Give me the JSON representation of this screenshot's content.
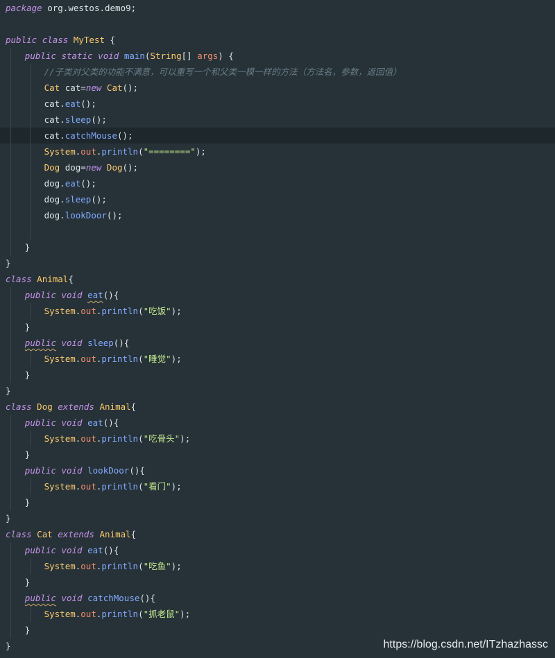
{
  "editor": {
    "theme": {
      "background": "#263238",
      "current_line": "#1e272c",
      "keyword": "#c792ea",
      "class_name": "#ffcb6b",
      "function": "#82aaff",
      "field": "#f78c6c",
      "string": "#c3e88d",
      "comment": "#697c86",
      "text": "#dde4e8"
    },
    "current_line_index": 8,
    "lines": [
      {
        "indent": 0,
        "tokens": [
          [
            "kw",
            "package"
          ],
          [
            "plain",
            " org.westos.demo9;"
          ]
        ]
      },
      {
        "indent": 0,
        "tokens": []
      },
      {
        "indent": 0,
        "tokens": [
          [
            "kw",
            "public"
          ],
          [
            "plain",
            " "
          ],
          [
            "kw",
            "class"
          ],
          [
            "plain",
            " "
          ],
          [
            "cls",
            "MyTest"
          ],
          [
            "plain",
            " {"
          ]
        ]
      },
      {
        "indent": 1,
        "tokens": [
          [
            "kw",
            "public"
          ],
          [
            "plain",
            " "
          ],
          [
            "kw",
            "static"
          ],
          [
            "plain",
            " "
          ],
          [
            "kw",
            "void"
          ],
          [
            "plain",
            " "
          ],
          [
            "fn",
            "main"
          ],
          [
            "plain",
            "("
          ],
          [
            "cls",
            "String"
          ],
          [
            "plain",
            "[] "
          ],
          [
            "param",
            "args"
          ],
          [
            "plain",
            ") {"
          ]
        ]
      },
      {
        "indent": 2,
        "tokens": [
          [
            "cmt",
            "//子类对父类的功能不满意，可以重写一个和父类一模一样的方法（方法名，参数，返回值）"
          ]
        ]
      },
      {
        "indent": 2,
        "tokens": [
          [
            "cls",
            "Cat"
          ],
          [
            "plain",
            " cat="
          ],
          [
            "kw",
            "new"
          ],
          [
            "plain",
            " "
          ],
          [
            "cls",
            "Cat"
          ],
          [
            "plain",
            "();"
          ]
        ]
      },
      {
        "indent": 2,
        "tokens": [
          [
            "plain",
            "cat."
          ],
          [
            "fn",
            "eat"
          ],
          [
            "plain",
            "();"
          ]
        ]
      },
      {
        "indent": 2,
        "tokens": [
          [
            "plain",
            "cat."
          ],
          [
            "fn",
            "sleep"
          ],
          [
            "plain",
            "();"
          ]
        ]
      },
      {
        "indent": 2,
        "tokens": [
          [
            "plain",
            "cat."
          ],
          [
            "fn",
            "catchMouse"
          ],
          [
            "plain",
            "();"
          ]
        ]
      },
      {
        "indent": 2,
        "tokens": [
          [
            "cls",
            "System"
          ],
          [
            "plain",
            "."
          ],
          [
            "mem",
            "out"
          ],
          [
            "plain",
            "."
          ],
          [
            "fn",
            "println"
          ],
          [
            "plain",
            "("
          ],
          [
            "str",
            "\"========\""
          ],
          [
            "plain",
            ");"
          ]
        ]
      },
      {
        "indent": 2,
        "tokens": [
          [
            "cls",
            "Dog"
          ],
          [
            "plain",
            " dog="
          ],
          [
            "kw",
            "new"
          ],
          [
            "plain",
            " "
          ],
          [
            "cls",
            "Dog"
          ],
          [
            "plain",
            "();"
          ]
        ]
      },
      {
        "indent": 2,
        "tokens": [
          [
            "plain",
            "dog."
          ],
          [
            "fn",
            "eat"
          ],
          [
            "plain",
            "();"
          ]
        ]
      },
      {
        "indent": 2,
        "tokens": [
          [
            "plain",
            "dog."
          ],
          [
            "fn",
            "sleep"
          ],
          [
            "plain",
            "();"
          ]
        ]
      },
      {
        "indent": 2,
        "tokens": [
          [
            "plain",
            "dog."
          ],
          [
            "fn",
            "lookDoor"
          ],
          [
            "plain",
            "();"
          ]
        ]
      },
      {
        "indent": 2,
        "tokens": []
      },
      {
        "indent": 1,
        "tokens": [
          [
            "plain",
            "}"
          ]
        ]
      },
      {
        "indent": 0,
        "tokens": [
          [
            "plain",
            "}"
          ]
        ]
      },
      {
        "indent": 0,
        "tokens": [
          [
            "kw",
            "class"
          ],
          [
            "plain",
            " "
          ],
          [
            "cls",
            "Animal"
          ],
          [
            "plain",
            "{"
          ]
        ]
      },
      {
        "indent": 1,
        "tokens": [
          [
            "kw",
            "public"
          ],
          [
            "plain",
            " "
          ],
          [
            "kw",
            "void"
          ],
          [
            "plain",
            " "
          ],
          [
            "fn-warn",
            "eat"
          ],
          [
            "plain",
            "(){"
          ]
        ]
      },
      {
        "indent": 2,
        "tokens": [
          [
            "cls",
            "System"
          ],
          [
            "plain",
            "."
          ],
          [
            "mem",
            "out"
          ],
          [
            "plain",
            "."
          ],
          [
            "fn",
            "println"
          ],
          [
            "plain",
            "("
          ],
          [
            "str",
            "\"吃饭\""
          ],
          [
            "plain",
            ");"
          ]
        ]
      },
      {
        "indent": 1,
        "tokens": [
          [
            "plain",
            "}"
          ]
        ]
      },
      {
        "indent": 1,
        "tokens": [
          [
            "kw-warn",
            "public"
          ],
          [
            "plain",
            " "
          ],
          [
            "kw",
            "void"
          ],
          [
            "plain",
            " "
          ],
          [
            "fn",
            "sleep"
          ],
          [
            "plain",
            "(){"
          ]
        ]
      },
      {
        "indent": 2,
        "tokens": [
          [
            "cls",
            "System"
          ],
          [
            "plain",
            "."
          ],
          [
            "mem",
            "out"
          ],
          [
            "plain",
            "."
          ],
          [
            "fn",
            "println"
          ],
          [
            "plain",
            "("
          ],
          [
            "str",
            "\"睡觉\""
          ],
          [
            "plain",
            ");"
          ]
        ]
      },
      {
        "indent": 1,
        "tokens": [
          [
            "plain",
            "}"
          ]
        ]
      },
      {
        "indent": 0,
        "tokens": [
          [
            "plain",
            "}"
          ]
        ]
      },
      {
        "indent": 0,
        "tokens": [
          [
            "kw",
            "class"
          ],
          [
            "plain",
            " "
          ],
          [
            "cls",
            "Dog"
          ],
          [
            "plain",
            " "
          ],
          [
            "kw",
            "extends"
          ],
          [
            "plain",
            " "
          ],
          [
            "cls",
            "Animal"
          ],
          [
            "plain",
            "{"
          ]
        ]
      },
      {
        "indent": 1,
        "tokens": [
          [
            "kw",
            "public"
          ],
          [
            "plain",
            " "
          ],
          [
            "kw",
            "void"
          ],
          [
            "plain",
            " "
          ],
          [
            "fn",
            "eat"
          ],
          [
            "plain",
            "(){"
          ]
        ]
      },
      {
        "indent": 2,
        "tokens": [
          [
            "cls",
            "System"
          ],
          [
            "plain",
            "."
          ],
          [
            "mem",
            "out"
          ],
          [
            "plain",
            "."
          ],
          [
            "fn",
            "println"
          ],
          [
            "plain",
            "("
          ],
          [
            "str",
            "\"吃骨头\""
          ],
          [
            "plain",
            ");"
          ]
        ]
      },
      {
        "indent": 1,
        "tokens": [
          [
            "plain",
            "}"
          ]
        ]
      },
      {
        "indent": 1,
        "tokens": [
          [
            "kw",
            "public"
          ],
          [
            "plain",
            " "
          ],
          [
            "kw",
            "void"
          ],
          [
            "plain",
            " "
          ],
          [
            "fn",
            "lookDoor"
          ],
          [
            "plain",
            "(){"
          ]
        ]
      },
      {
        "indent": 2,
        "tokens": [
          [
            "cls",
            "System"
          ],
          [
            "plain",
            "."
          ],
          [
            "mem",
            "out"
          ],
          [
            "plain",
            "."
          ],
          [
            "fn",
            "println"
          ],
          [
            "plain",
            "("
          ],
          [
            "str",
            "\"看门\""
          ],
          [
            "plain",
            ");"
          ]
        ]
      },
      {
        "indent": 1,
        "tokens": [
          [
            "plain",
            "}"
          ]
        ]
      },
      {
        "indent": 0,
        "tokens": [
          [
            "plain",
            "}"
          ]
        ]
      },
      {
        "indent": 0,
        "tokens": [
          [
            "kw",
            "class"
          ],
          [
            "plain",
            " "
          ],
          [
            "cls",
            "Cat"
          ],
          [
            "plain",
            " "
          ],
          [
            "kw",
            "extends"
          ],
          [
            "plain",
            " "
          ],
          [
            "cls",
            "Animal"
          ],
          [
            "plain",
            "{"
          ]
        ]
      },
      {
        "indent": 1,
        "tokens": [
          [
            "kw",
            "public"
          ],
          [
            "plain",
            " "
          ],
          [
            "kw",
            "void"
          ],
          [
            "plain",
            " "
          ],
          [
            "fn",
            "eat"
          ],
          [
            "plain",
            "(){"
          ]
        ]
      },
      {
        "indent": 2,
        "tokens": [
          [
            "cls",
            "System"
          ],
          [
            "plain",
            "."
          ],
          [
            "mem",
            "out"
          ],
          [
            "plain",
            "."
          ],
          [
            "fn",
            "println"
          ],
          [
            "plain",
            "("
          ],
          [
            "str",
            "\"吃鱼\""
          ],
          [
            "plain",
            ");"
          ]
        ]
      },
      {
        "indent": 1,
        "tokens": [
          [
            "plain",
            "}"
          ]
        ]
      },
      {
        "indent": 1,
        "tokens": [
          [
            "kw-warn",
            "public"
          ],
          [
            "plain",
            " "
          ],
          [
            "kw",
            "void"
          ],
          [
            "plain",
            " "
          ],
          [
            "fn",
            "catchMouse"
          ],
          [
            "plain",
            "(){"
          ]
        ]
      },
      {
        "indent": 2,
        "tokens": [
          [
            "cls",
            "System"
          ],
          [
            "plain",
            "."
          ],
          [
            "mem",
            "out"
          ],
          [
            "plain",
            "."
          ],
          [
            "fn",
            "println"
          ],
          [
            "plain",
            "("
          ],
          [
            "str",
            "\"抓老鼠\""
          ],
          [
            "plain",
            ");"
          ]
        ]
      },
      {
        "indent": 1,
        "tokens": [
          [
            "plain",
            "}"
          ]
        ]
      },
      {
        "indent": 0,
        "tokens": [
          [
            "plain",
            "}"
          ]
        ]
      }
    ]
  },
  "watermark": {
    "text": "https://blog.csdn.net/ITzhazhassc"
  }
}
